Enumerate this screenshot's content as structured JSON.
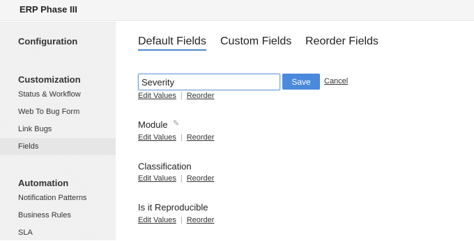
{
  "header": {
    "project_name": "ERP Phase III"
  },
  "sidebar": {
    "sections": [
      {
        "title": "Configuration",
        "items": []
      },
      {
        "title": "Customization",
        "items": [
          "Status & Workflow",
          "Web To Bug Form",
          "Link Bugs",
          "Fields"
        ]
      },
      {
        "title": "Automation",
        "items": [
          "Notification Patterns",
          "Business Rules",
          "SLA"
        ]
      }
    ],
    "active_item": "Fields"
  },
  "tabs": [
    {
      "label": "Default Fields",
      "active": true
    },
    {
      "label": "Custom Fields",
      "active": false
    },
    {
      "label": "Reorder Fields",
      "active": false
    }
  ],
  "editor": {
    "value": "Severity",
    "save_label": "Save",
    "cancel_label": "Cancel",
    "edit_values_label": "Edit Values",
    "reorder_label": "Reorder",
    "separator": "|"
  },
  "fields": [
    {
      "name": "Module",
      "edit_values_label": "Edit Values",
      "reorder_label": "Reorder",
      "separator": "|",
      "icon": "pencil-icon"
    },
    {
      "name": "Classification",
      "edit_values_label": "Edit Values",
      "reorder_label": "Reorder",
      "separator": "|"
    },
    {
      "name": "Is it Reproducible",
      "edit_values_label": "Edit Values",
      "reorder_label": "Reorder",
      "separator": "|"
    }
  ],
  "colors": {
    "accent": "#4a89dc",
    "tab_underline": "#4a86cf",
    "sidebar_bg": "#f2f2f2"
  }
}
